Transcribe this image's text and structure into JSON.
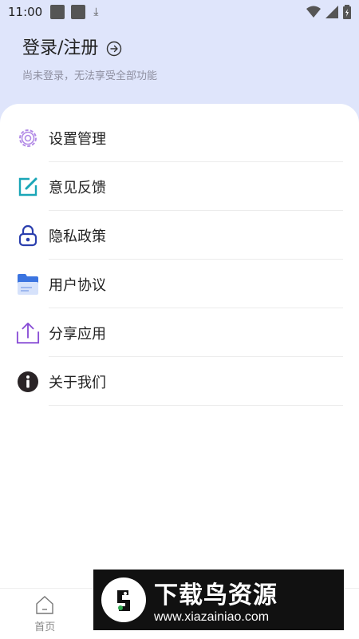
{
  "status": {
    "time": "11:00"
  },
  "login": {
    "title": "登录/注册",
    "subtitle": "尚未登录，无法享受全部功能"
  },
  "menu": [
    {
      "label": "设置管理",
      "icon": "gear-icon",
      "color": "#b28ae6"
    },
    {
      "label": "意见反馈",
      "icon": "edit-icon",
      "color": "#1aa6b7"
    },
    {
      "label": "隐私政策",
      "icon": "lock-icon",
      "color": "#2b3fae"
    },
    {
      "label": "用户协议",
      "icon": "document-icon",
      "color": "#3b74e0"
    },
    {
      "label": "分享应用",
      "icon": "share-icon",
      "color": "#8a4fd6"
    },
    {
      "label": "关于我们",
      "icon": "info-icon",
      "color": "#222222"
    }
  ],
  "nav": {
    "home": "首页",
    "second": "",
    "third": "",
    "settings": ""
  },
  "watermark": {
    "title": "下载鸟资源",
    "url": "www.xiazainiao.com"
  }
}
